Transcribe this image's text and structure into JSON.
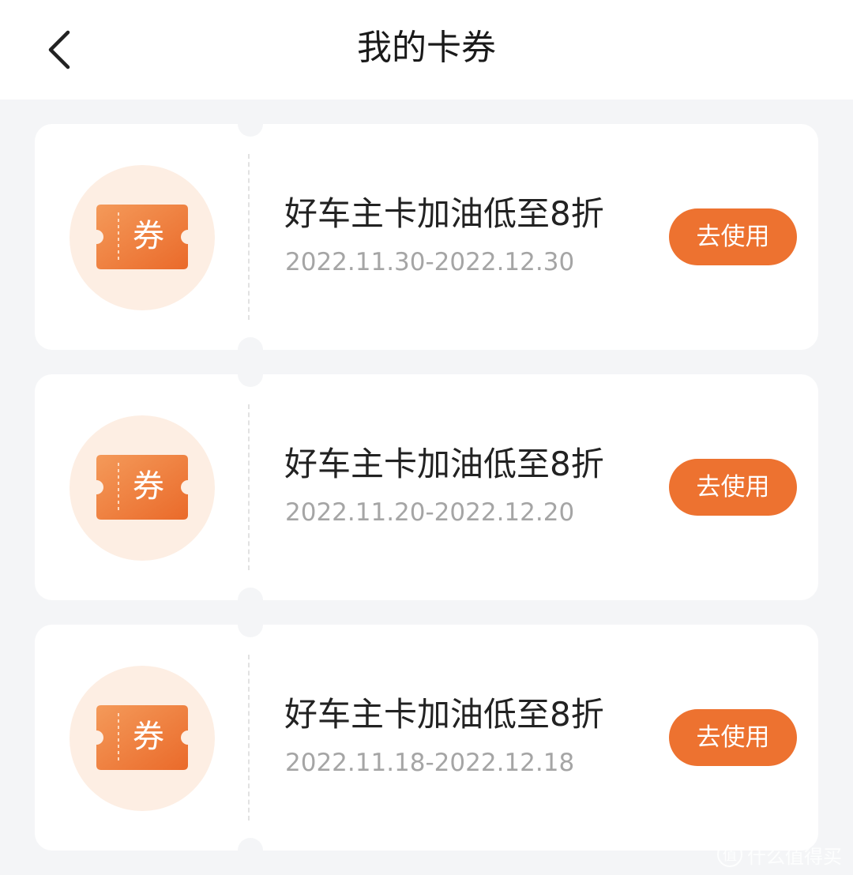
{
  "header": {
    "title": "我的卡券",
    "back_icon": "chevron-left-icon"
  },
  "colors": {
    "accent": "#ed7230",
    "icon_bg": "#fdeee3",
    "page_bg": "#f4f5f7"
  },
  "coupons": [
    {
      "icon_label": "券",
      "title": "好车主卡加油低至8折",
      "date_range": "2022.11.30-2022.12.30",
      "button_label": "去使用"
    },
    {
      "icon_label": "券",
      "title": "好车主卡加油低至8折",
      "date_range": "2022.11.20-2022.12.20",
      "button_label": "去使用"
    },
    {
      "icon_label": "券",
      "title": "好车主卡加油低至8折",
      "date_range": "2022.11.18-2022.12.18",
      "button_label": "去使用"
    }
  ],
  "watermark": {
    "logo_char": "值",
    "text": "什么值得买"
  }
}
